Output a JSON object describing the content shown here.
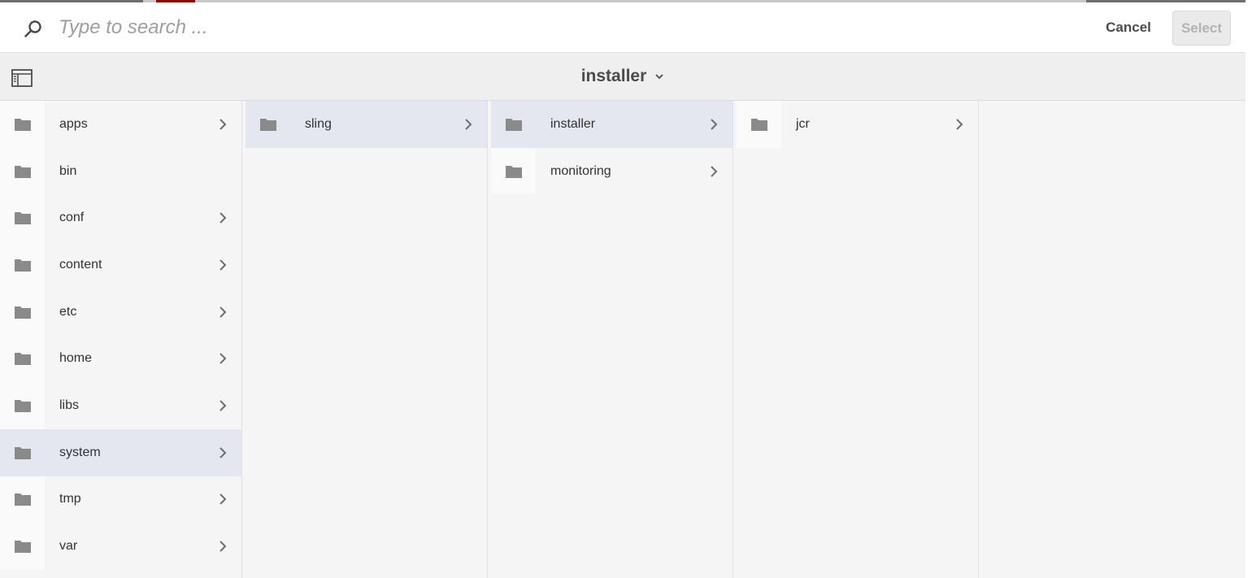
{
  "search": {
    "placeholder": "Type to search ..."
  },
  "actions": {
    "cancel_label": "Cancel",
    "select_label": "Select"
  },
  "header": {
    "title": "installer"
  },
  "columns": [
    {
      "items": [
        {
          "label": "apps",
          "has_children": true,
          "selected": false
        },
        {
          "label": "bin",
          "has_children": false,
          "selected": false
        },
        {
          "label": "conf",
          "has_children": true,
          "selected": false
        },
        {
          "label": "content",
          "has_children": true,
          "selected": false
        },
        {
          "label": "etc",
          "has_children": true,
          "selected": false
        },
        {
          "label": "home",
          "has_children": true,
          "selected": false
        },
        {
          "label": "libs",
          "has_children": true,
          "selected": false
        },
        {
          "label": "system",
          "has_children": true,
          "selected": true
        },
        {
          "label": "tmp",
          "has_children": true,
          "selected": false
        },
        {
          "label": "var",
          "has_children": true,
          "selected": false
        }
      ]
    },
    {
      "items": [
        {
          "label": "sling",
          "has_children": true,
          "selected": true
        }
      ]
    },
    {
      "items": [
        {
          "label": "installer",
          "has_children": true,
          "selected": true
        },
        {
          "label": "monitoring",
          "has_children": true,
          "selected": false
        }
      ]
    },
    {
      "items": [
        {
          "label": "jcr",
          "has_children": true,
          "selected": false
        }
      ]
    }
  ],
  "colors": {
    "selected_row": "#e4e7f0",
    "folder_icon": "#8a8a8a",
    "disabled_button": "#b3b3b3"
  },
  "icons": {
    "search": "search-icon",
    "rail": "rail-toggle-icon",
    "folder": "folder-icon",
    "chevron": "chevron-right-icon",
    "dropdown": "chevron-down-icon"
  }
}
